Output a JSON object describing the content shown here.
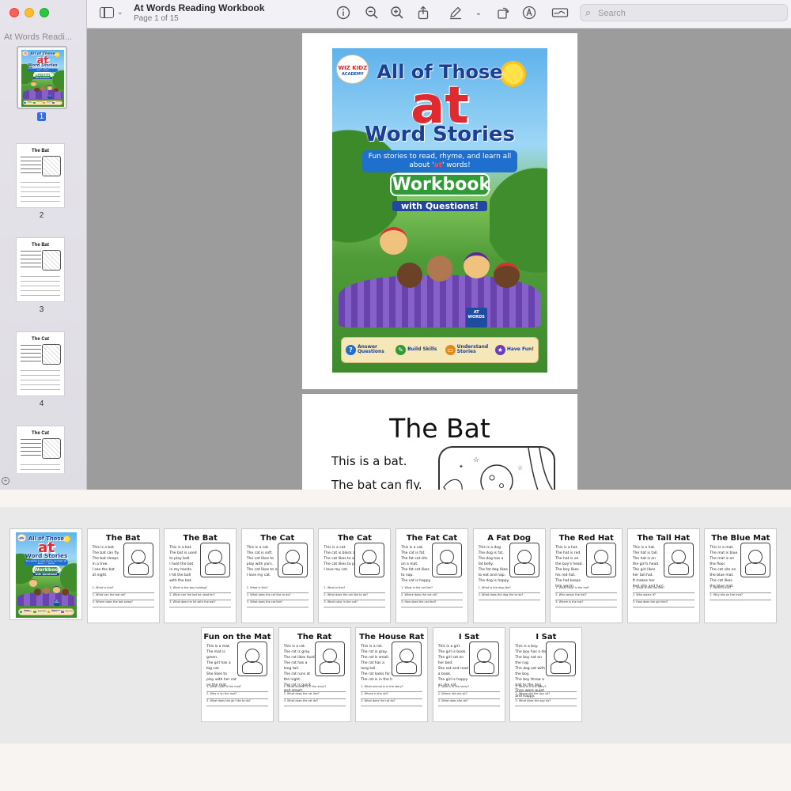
{
  "window": {
    "title": "At Words Reading Workbook",
    "subtitle": "Page 1 of 15",
    "sidebar_title": "At Words Readi...",
    "search_placeholder": "Search"
  },
  "toolbar_icons": [
    "sidebar-toggle-icon",
    "info-icon",
    "zoom-out-icon",
    "zoom-in-icon",
    "share-icon",
    "markup-icon",
    "rotate-icon",
    "highlight-icon",
    "signature-icon",
    "search-icon"
  ],
  "cover": {
    "logo_main": "WIZ KIDZ",
    "logo_sub": "ACADEMY",
    "title_top": "All of Those",
    "title_big": "at",
    "title_bottom": "Word Stories",
    "ribbon_pre": "Fun stories to read, rhyme, and learn all about '",
    "ribbon_hl": "at",
    "ribbon_post": "' words!",
    "workbook": "Workbook",
    "with_questions": "with Questions!",
    "book_label": "AT WORDS",
    "features": [
      {
        "icon": "?",
        "label": "Answer Questions",
        "color": "#1f6fcf"
      },
      {
        "icon": "✎",
        "label": "Build Skills",
        "color": "#2f9a36"
      },
      {
        "icon": "▭",
        "label": "Understand Stories",
        "color": "#e08a1e"
      },
      {
        "icon": "★",
        "label": "Have Fun!",
        "color": "#6a3fb5"
      }
    ]
  },
  "page2": {
    "title": "The Bat",
    "lines": [
      "This is a bat.",
      "The bat can fly."
    ]
  },
  "sidebar_thumbs": [
    {
      "num": "1",
      "type": "cover"
    },
    {
      "num": "2",
      "title": "The Bat"
    },
    {
      "num": "3",
      "title": "The Bat"
    },
    {
      "num": "4",
      "title": "The Cat"
    },
    {
      "num": "",
      "title": "The Cat"
    }
  ],
  "grid_pages": [
    {
      "type": "cover"
    },
    {
      "title": "The Bat",
      "lines": [
        "This is a bat.",
        "The bat can fly.",
        "The bat sleeps",
        "in a tree.",
        "I see the bat",
        "at night."
      ],
      "questions": [
        "1. What is this?",
        "2. What can the bat do?",
        "3. Where does the bat sleep?"
      ]
    },
    {
      "title": "The Bat",
      "lines": [
        "This is a bat.",
        "The bat is used",
        "to play ball.",
        "I hold the bat",
        "in my hands.",
        "I hit the ball",
        "with the bat."
      ],
      "questions": [
        "1. What is the boy holding?",
        "2. What can the bat be used for?",
        "3. What does he hit with the bat?"
      ]
    },
    {
      "title": "The Cat",
      "lines": [
        "This is a cat.",
        "The cat is soft.",
        "The cat likes to",
        "play with yarn.",
        "The cat likes to nap.",
        "I love my cat."
      ],
      "questions": [
        "1. What is this?",
        "2. What does the cat like to do?",
        "3. What does the cat like?"
      ]
    },
    {
      "title": "The Cat",
      "lines": [
        "This is a cat.",
        "The cat is black and white.",
        "The cat likes to sit.",
        "The cat likes to purr.",
        "I love my cat."
      ],
      "questions": [
        "1. What is this?",
        "2. What does the cat like to do?",
        "3. What color is the cat?"
      ]
    },
    {
      "title": "The Fat Cat",
      "lines": [
        "This is a cat.",
        "The cat is fat.",
        "The fat cat sits",
        "on a mat.",
        "The fat cat likes",
        "to nap.",
        "The cat is happy."
      ],
      "questions": [
        "1. What is the cat like?",
        "2. Where does the cat sit?",
        "3. How does the cat feel?"
      ]
    },
    {
      "title": "A Fat Dog",
      "lines": [
        "This is a dog.",
        "The dog is fat.",
        "The dog has a",
        "fat belly.",
        "The fat dog likes",
        "to eat and nap.",
        "The dog is happy."
      ],
      "questions": [
        "1. What is the dog like?",
        "2. What does the dog like to do?"
      ]
    },
    {
      "title": "The Red Hat",
      "lines": [
        "This is a hat.",
        "The hat is red.",
        "The hat is on",
        "the boy's head.",
        "The boy likes",
        "his red hat.",
        "The hat keeps",
        "him warm."
      ],
      "questions": [
        "1. What color is the hat?",
        "2. Who wears the hat?",
        "3. Where is the hat?"
      ]
    },
    {
      "title": "The Tall Hat",
      "lines": [
        "This is a hat.",
        "The hat is tall.",
        "The hat is on",
        "the girl's head.",
        "The girl likes",
        "her tall hat.",
        "It makes her",
        "feel silly and fun!"
      ],
      "questions": [
        "1. What is the hat like?",
        "2. Who wears it?",
        "3. How does the girl feel?"
      ]
    },
    {
      "title": "The Blue Mat",
      "lines": [
        "This is a mat.",
        "The mat is blue.",
        "The mat is on",
        "the floor.",
        "The cat sits on",
        "the blue mat.",
        "The cat likes",
        "the blue mat."
      ],
      "questions": [
        "1. What is this?",
        "2. Why sits on the mat?"
      ]
    },
    {
      "title": "Fun on the Mat",
      "lines": [
        "This is a mat.",
        "The mat is",
        "green.",
        "The girl has a",
        "big cat.",
        "She likes to",
        "play with her cat",
        "on the mat."
      ],
      "questions": [
        "1. What color is the mat?",
        "2. Who is on the mat?",
        "3. What does the girl like to do?"
      ]
    },
    {
      "title": "The Rat",
      "lines": [
        "This is a rat.",
        "The rat is gray.",
        "The rat likes food.",
        "The rat has a",
        "long tail.",
        "The rat runs at",
        "the night.",
        "The rat is quick",
        "and smart."
      ],
      "questions": [
        "1. What animal is in the story?",
        "2. What does the rat like?",
        "3. What does the rat do?"
      ]
    },
    {
      "title": "The House Rat",
      "lines": [
        "This is a rat.",
        "The rat is gray.",
        "The rat is small.",
        "The rat has a",
        "long tail.",
        "The rat looks for food.",
        "The rat is in the house."
      ],
      "questions": [
        "1. What animal is in the story?",
        "2. Where is the rat?",
        "3. What does the rat do?"
      ]
    },
    {
      "title": "I Sat",
      "lines": [
        "This is a girl.",
        "The girl is book.",
        "The girl sat on",
        "her bed.",
        "She sat and read",
        "a book.",
        "The girl is happy",
        "as she sat."
      ],
      "questions": [
        "1. Who is in the story?",
        "2. Where did she sit?",
        "3. What does she do?"
      ]
    },
    {
      "title": "I Sat",
      "lines": [
        "This is a boy.",
        "The boy has a dog.",
        "The boy sat on",
        "the rug.",
        "The dog sat with",
        "the boy.",
        "The boy threw a",
        "ball to the dog.",
        "They were quiet",
        "and happy."
      ],
      "questions": [
        "1. Who is in the story?",
        "2. Where did the boy sit?",
        "3. What does the boy do?"
      ]
    }
  ]
}
